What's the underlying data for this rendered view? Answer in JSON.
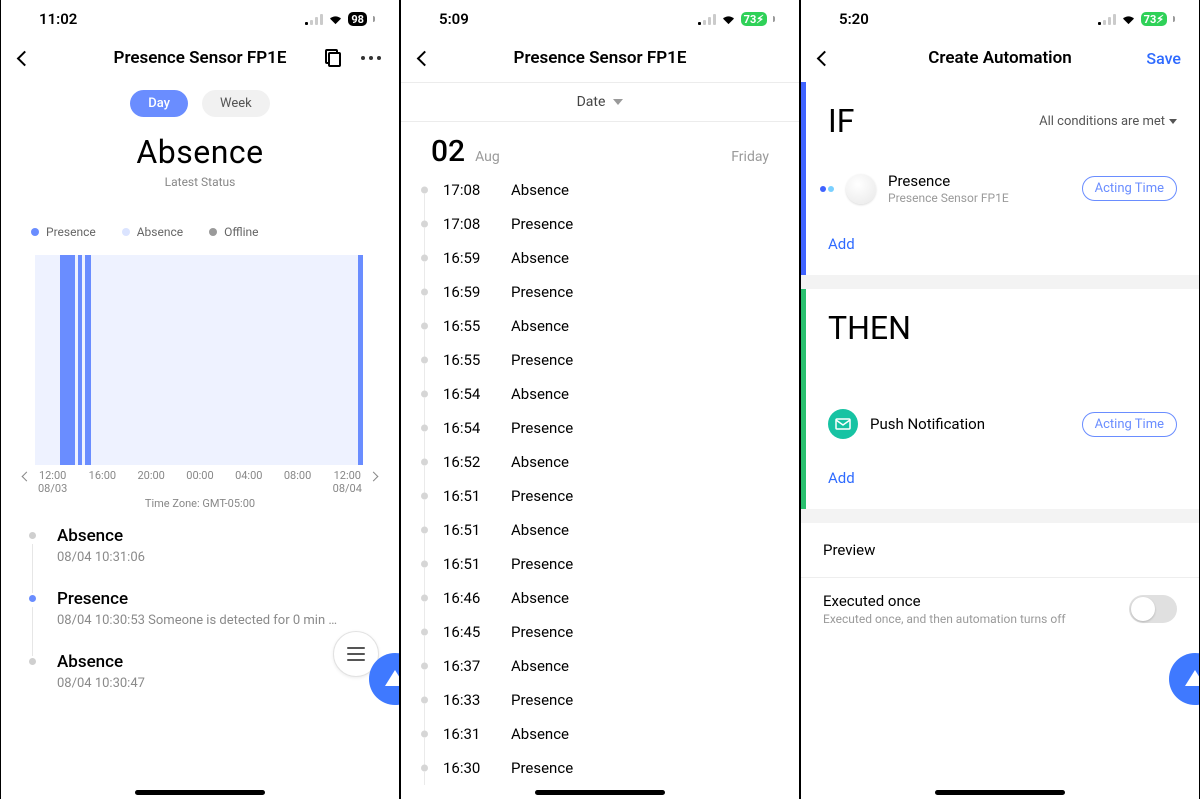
{
  "s1": {
    "status": {
      "time": "11:02",
      "battery": "98",
      "battery_color": "dark"
    },
    "nav": {
      "title": "Presence Sensor FP1E"
    },
    "tabs": {
      "day": "Day",
      "week": "Week"
    },
    "main_status": {
      "label": "Absence",
      "sub": "Latest Status"
    },
    "legend": {
      "presence": "Presence",
      "absence": "Absence",
      "offline": "Offline"
    },
    "axis": [
      {
        "t": "12:00",
        "d": "08/03"
      },
      {
        "t": "16:00",
        "d": ""
      },
      {
        "t": "20:00",
        "d": ""
      },
      {
        "t": "00:00",
        "d": ""
      },
      {
        "t": "04:00",
        "d": ""
      },
      {
        "t": "08:00",
        "d": ""
      },
      {
        "t": "12:00",
        "d": "08/04"
      }
    ],
    "tz": "Time Zone: GMT-05:00",
    "events": [
      {
        "title": "Absence",
        "detail": "08/04 10:31:06",
        "active": false
      },
      {
        "title": "Presence",
        "detail": "08/04 10:30:53 Someone is detected for 0 min …",
        "active": true
      },
      {
        "title": "Absence",
        "detail": "08/04 10:30:47",
        "active": false
      }
    ]
  },
  "s2": {
    "status": {
      "time": "5:09",
      "battery": "73",
      "battery_color": "green",
      "charging": true
    },
    "nav": {
      "title": "Presence Sensor FP1E"
    },
    "date_selector": "Date",
    "date": {
      "day": "02",
      "month": "Aug",
      "dow": "Friday"
    },
    "log": [
      {
        "t": "17:08",
        "s": "Absence"
      },
      {
        "t": "17:08",
        "s": "Presence"
      },
      {
        "t": "16:59",
        "s": "Absence"
      },
      {
        "t": "16:59",
        "s": "Presence"
      },
      {
        "t": "16:55",
        "s": "Absence"
      },
      {
        "t": "16:55",
        "s": "Presence"
      },
      {
        "t": "16:54",
        "s": "Absence"
      },
      {
        "t": "16:54",
        "s": "Presence"
      },
      {
        "t": "16:52",
        "s": "Absence"
      },
      {
        "t": "16:51",
        "s": "Presence"
      },
      {
        "t": "16:51",
        "s": "Absence"
      },
      {
        "t": "16:51",
        "s": "Presence"
      },
      {
        "t": "16:46",
        "s": "Absence"
      },
      {
        "t": "16:45",
        "s": "Presence"
      },
      {
        "t": "16:37",
        "s": "Absence"
      },
      {
        "t": "16:33",
        "s": "Presence"
      },
      {
        "t": "16:31",
        "s": "Absence"
      },
      {
        "t": "16:30",
        "s": "Presence"
      }
    ]
  },
  "s3": {
    "status": {
      "time": "5:20",
      "battery": "73",
      "battery_color": "green",
      "charging": true
    },
    "nav": {
      "title": "Create Automation",
      "save": "Save"
    },
    "if": {
      "title": "IF",
      "cond_mode": "All conditions are met",
      "item": {
        "title": "Presence",
        "detail": "Presence Sensor FP1E",
        "acting": "Acting Time"
      },
      "add": "Add"
    },
    "then": {
      "title": "THEN",
      "item": {
        "title": "Push Notification",
        "acting": "Acting Time"
      },
      "add": "Add"
    },
    "preview": "Preview",
    "exec": {
      "title": "Executed once",
      "detail": "Executed once, and then automation turns off"
    }
  }
}
